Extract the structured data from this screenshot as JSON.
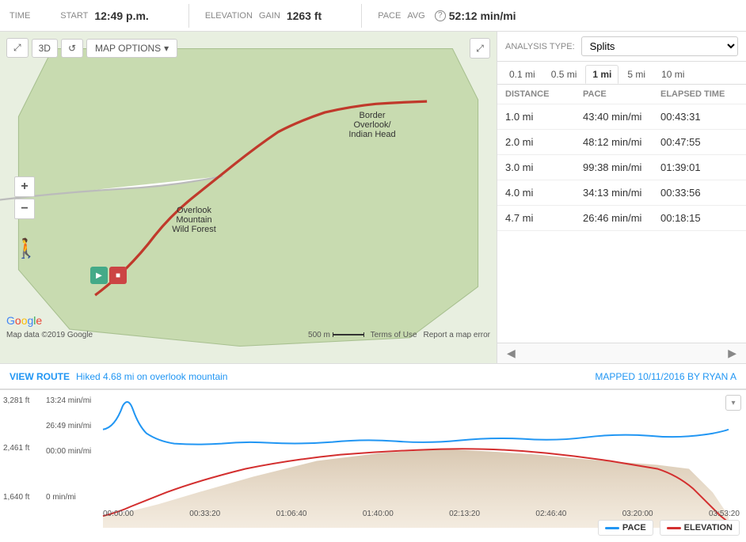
{
  "topbar": {
    "time_label": "TIME",
    "start_label": "START",
    "start_value": "12:49 p.m.",
    "elevation_label": "ELEVATION",
    "gain_label": "GAIN",
    "gain_value": "1263 ft",
    "pace_label": "PACE",
    "avg_label": "AVG",
    "avg_value": "52:12 min/mi"
  },
  "map": {
    "map_options_label": "MAP OPTIONS",
    "border_overlook": "Border\nOverlook/\nIndian Head",
    "overlook_mountain": "Overlook\nMountain\nWild Forest",
    "attribution": "Map data ©2019 Google",
    "scale": "500 m",
    "terms": "Terms of Use",
    "report": "Report a map error"
  },
  "analysis": {
    "type_label": "ANALYSIS TYPE:",
    "type_value": "Splits",
    "distance_tabs": [
      "0.1 mi",
      "0.5 mi",
      "1 mi",
      "5 mi",
      "10 mi"
    ],
    "active_tab": "1 mi",
    "table_headers": [
      "DISTANCE",
      "PACE",
      "ELAPSED TIME"
    ],
    "rows": [
      {
        "distance": "1.0 mi",
        "pace": "43:40 min/mi",
        "elapsed": "00:43:31"
      },
      {
        "distance": "2.0 mi",
        "pace": "48:12 min/mi",
        "elapsed": "00:47:55"
      },
      {
        "distance": "3.0 mi",
        "pace": "99:38 min/mi",
        "elapsed": "01:39:01"
      },
      {
        "distance": "4.0 mi",
        "pace": "34:13 min/mi",
        "elapsed": "00:33:56"
      },
      {
        "distance": "4.7 mi",
        "pace": "26:46 min/mi",
        "elapsed": "00:18:15"
      }
    ]
  },
  "view_route": {
    "label": "VIEW ROUTE",
    "description": "Hiked 4.68 mi on overlook mountain",
    "mapped_label": "MAPPED",
    "mapped_date": "10/11/2016",
    "by_label": "BY",
    "by_user": "RYAN A"
  },
  "chart": {
    "y_labels_left": [
      "3,281 ft",
      "2,461 ft",
      "1,640 ft"
    ],
    "y_labels_right": [
      "13:24 min/mi",
      "26:49 min/mi",
      "00:00 min/mi",
      "0 min/mi"
    ],
    "x_labels": [
      "00:00:00",
      "00:33:20",
      "01:06:40",
      "01:40:00",
      "02:13:20",
      "02:46:40",
      "03:20:00",
      "03:53:20"
    ],
    "pace_color": "#2196F3",
    "elevation_color": "#D32F2F",
    "legend_pace": "PACE",
    "legend_elevation": "ELEVATION"
  },
  "icons": {
    "expand": "⤢",
    "expand_map": "⤢",
    "three_d": "3D",
    "refresh": "↺",
    "chevron_down": "▾",
    "plus": "+",
    "minus": "−",
    "play": "▶",
    "stop": "■",
    "person": "🚶",
    "left_arrow": "◀",
    "right_arrow": "▶",
    "up_arrow": "▲",
    "down_arrow": "▼"
  }
}
